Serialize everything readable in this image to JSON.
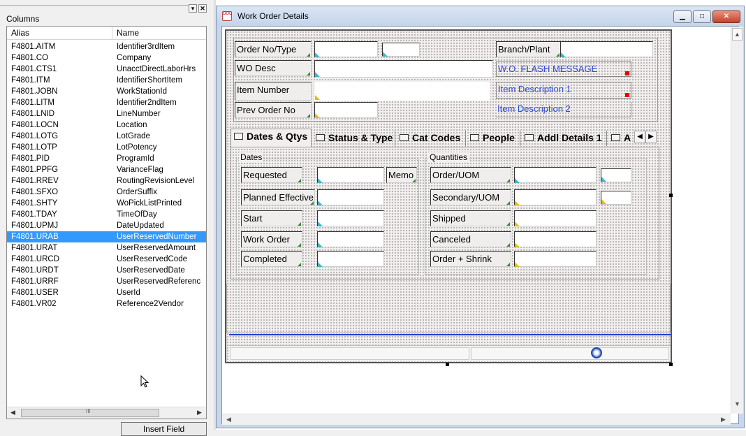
{
  "left_panel": {
    "title": "Columns",
    "headers": {
      "alias": "Alias",
      "name": "Name"
    },
    "rows": [
      {
        "alias": "F4801.AITM",
        "name": "Identifier3rdItem"
      },
      {
        "alias": "F4801.CO",
        "name": "Company"
      },
      {
        "alias": "F4801.CTS1",
        "name": "UnacctDirectLaborHrs"
      },
      {
        "alias": "F4801.ITM",
        "name": "IdentifierShortItem"
      },
      {
        "alias": "F4801.JOBN",
        "name": "WorkStationId"
      },
      {
        "alias": "F4801.LITM",
        "name": "Identifier2ndItem"
      },
      {
        "alias": "F4801.LNID",
        "name": "LineNumber"
      },
      {
        "alias": "F4801.LOCN",
        "name": "Location"
      },
      {
        "alias": "F4801.LOTG",
        "name": "LotGrade"
      },
      {
        "alias": "F4801.LOTP",
        "name": "LotPotency"
      },
      {
        "alias": "F4801.PID",
        "name": "ProgramId"
      },
      {
        "alias": "F4801.PPFG",
        "name": "VarianceFlag"
      },
      {
        "alias": "F4801.RREV",
        "name": "RoutingRevisionLevel"
      },
      {
        "alias": "F4801.SFXO",
        "name": "OrderSuffix"
      },
      {
        "alias": "F4801.SHTY",
        "name": "WoPickListPrinted"
      },
      {
        "alias": "F4801.TDAY",
        "name": "TimeOfDay"
      },
      {
        "alias": "F4801.UPMJ",
        "name": "DateUpdated"
      },
      {
        "alias": "F4801.URAB",
        "name": "UserReservedNumber"
      },
      {
        "alias": "F4801.URAT",
        "name": "UserReservedAmount"
      },
      {
        "alias": "F4801.URCD",
        "name": "UserReservedCode"
      },
      {
        "alias": "F4801.URDT",
        "name": "UserReservedDate"
      },
      {
        "alias": "F4801.URRF",
        "name": "UserReservedReferenc"
      },
      {
        "alias": "F4801.USER",
        "name": "UserId"
      },
      {
        "alias": "F4801.VR02",
        "name": "Reference2Vendor"
      }
    ],
    "selected_index": 17,
    "insert_button": "Insert Field",
    "scroll_grip": "III"
  },
  "window": {
    "title": "Work Order Details",
    "icon_text": "DOC"
  },
  "header_fields": {
    "order_no_type": "Order No/Type",
    "branch_plant": "Branch/Plant",
    "wo_desc": "WO Desc",
    "flash_message": "W.O. FLASH MESSAGE",
    "item_number": "Item Number",
    "item_description_1": "Item Description 1",
    "prev_order_no": "Prev Order No",
    "item_description_2": "Item Description 2"
  },
  "tabs": [
    "Dates & Qtys",
    "Status & Type",
    "Cat Codes",
    "People",
    "Addl Details 1",
    "A"
  ],
  "dates": {
    "title": "Dates",
    "fields": [
      "Requested",
      "Planned Effective",
      "Start",
      "Work Order",
      "Completed"
    ],
    "memo": "Memo"
  },
  "quantities": {
    "title": "Quantities",
    "fields": [
      "Order/UOM",
      "Secondary/UOM",
      "Shipped",
      "Canceled",
      "Order + Shrink"
    ]
  },
  "colors": {
    "selection": "#3399ff",
    "flash_text": "#2b4cd6",
    "footer_line": "#2040d0"
  }
}
